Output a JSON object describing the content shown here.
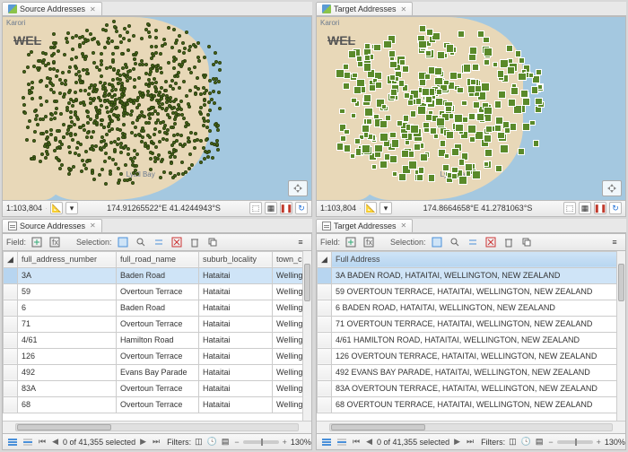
{
  "left": {
    "map_tab_title": "Source Addresses",
    "scale": "1:103,804",
    "coords": "174.91265522°E 41.4244943°S",
    "table_tab_title": "Source Addresses",
    "field_label": "Field:",
    "selection_label": "Selection:",
    "columns": [
      "full_address_number",
      "full_road_name",
      "suburb_locality",
      "town_city"
    ],
    "rows": [
      {
        "num": "3A",
        "road": "Baden Road",
        "suburb": "Hataitai",
        "city": "Wellington",
        "sel": true
      },
      {
        "num": "59",
        "road": "Overtoun Terrace",
        "suburb": "Hataitai",
        "city": "Wellington"
      },
      {
        "num": "6",
        "road": "Baden Road",
        "suburb": "Hataitai",
        "city": "Wellington"
      },
      {
        "num": "71",
        "road": "Overtoun Terrace",
        "suburb": "Hataitai",
        "city": "Wellington"
      },
      {
        "num": "4/61",
        "road": "Hamilton Road",
        "suburb": "Hataitai",
        "city": "Wellington"
      },
      {
        "num": "126",
        "road": "Overtoun Terrace",
        "suburb": "Hataitai",
        "city": "Wellington"
      },
      {
        "num": "492",
        "road": "Evans Bay Parade",
        "suburb": "Hataitai",
        "city": "Wellington"
      },
      {
        "num": "83A",
        "road": "Overtoun Terrace",
        "suburb": "Hataitai",
        "city": "Wellington"
      },
      {
        "num": "68",
        "road": "Overtoun Terrace",
        "suburb": "Hataitai",
        "city": "Wellington"
      }
    ],
    "record_status": "0 of 41,355 selected",
    "filters_label": "Filters:",
    "zoom": "130%"
  },
  "right": {
    "map_tab_title": "Target Addresses",
    "scale": "1:103,804",
    "coords": "174.8664658°E 41.2781063°S",
    "table_tab_title": "Target Addresses",
    "field_label": "Field:",
    "selection_label": "Selection:",
    "columns": [
      "Full Address"
    ],
    "rows": [
      {
        "addr": "3A BADEN ROAD, HATAITAI, WELLINGTON, NEW ZEALAND",
        "sel": true
      },
      {
        "addr": "59 OVERTOUN TERRACE, HATAITAI, WELLINGTON, NEW ZEALAND"
      },
      {
        "addr": "6 BADEN ROAD, HATAITAI, WELLINGTON, NEW ZEALAND"
      },
      {
        "addr": "71 OVERTOUN TERRACE, HATAITAI, WELLINGTON, NEW ZEALAND"
      },
      {
        "addr": "4/61 HAMILTON ROAD, HATAITAI, WELLINGTON, NEW ZEALAND"
      },
      {
        "addr": "126 OVERTOUN TERRACE, HATAITAI, WELLINGTON, NEW ZEALAND"
      },
      {
        "addr": "492 EVANS BAY PARADE, HATAITAI, WELLINGTON, NEW ZEALAND"
      },
      {
        "addr": "83A OVERTOUN TERRACE, HATAITAI, WELLINGTON, NEW ZEALAND"
      },
      {
        "addr": "68 OVERTOUN TERRACE, HATAITAI, WELLINGTON, NEW ZEALAND"
      }
    ],
    "record_status": "0 of 41,355 selected",
    "filters_label": "Filters:",
    "zoom": "130%"
  },
  "map_labels": {
    "karori": "Karori",
    "wel": "WEL",
    "lyall": "Lyall Bay"
  }
}
